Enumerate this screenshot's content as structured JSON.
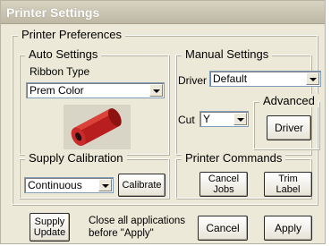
{
  "window": {
    "title": "Printer Settings"
  },
  "printer_preferences": {
    "legend": "Printer Preferences"
  },
  "auto_settings": {
    "legend": "Auto Settings",
    "ribbon_type_label": "Ribbon Type",
    "ribbon_type_value": "Prem Color",
    "ribbon_image": "red-ribbon-roll"
  },
  "manual_settings": {
    "legend": "Manual Settings",
    "driver_label": "Driver",
    "driver_value": "Default",
    "cut_label": "Cut",
    "cut_value": "Y"
  },
  "advanced": {
    "legend": "Advanced",
    "driver_button": "Driver"
  },
  "supply_calibration": {
    "legend": "Supply Calibration",
    "mode_value": "Continuous",
    "calibrate_button": "Calibrate"
  },
  "printer_commands": {
    "legend": "Printer Commands",
    "cancel_jobs_button": "Cancel\nJobs",
    "trim_label_button": "Trim\nLabel"
  },
  "footer": {
    "supply_update_button": "Supply\nUpdate",
    "note_line1": "Close all applications",
    "note_line2": "before \"Apply\"",
    "cancel_button": "Cancel",
    "apply_button": "Apply"
  },
  "colors": {
    "ribbon": "#b81e1e",
    "dialog_bg": "#ece9d8"
  }
}
